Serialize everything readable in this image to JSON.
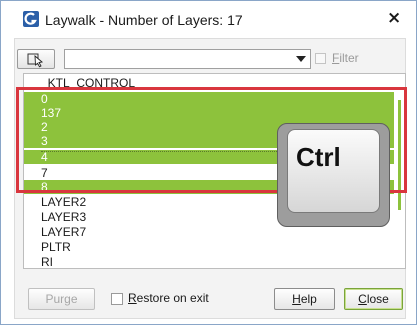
{
  "window": {
    "title": "Laywalk - Number of Layers: 17",
    "close_glyph": "×",
    "app_icon": "autocad-g-icon"
  },
  "toolbar": {
    "pick_icon": "select-objects-icon",
    "filter_value": "",
    "filter_checked": false,
    "filter_label_first": "F",
    "filter_label_rest": "ilter"
  },
  "layers": [
    {
      "name": "_KTL_CONTROL",
      "selected": false
    },
    {
      "name": "0",
      "selected": true
    },
    {
      "name": "137",
      "selected": true
    },
    {
      "name": "2",
      "selected": true
    },
    {
      "name": "3",
      "selected": true
    },
    {
      "name": "4",
      "selected": true
    },
    {
      "name": "7",
      "selected": false
    },
    {
      "name": "8",
      "selected": true
    },
    {
      "name": "LAYER2",
      "selected": false
    },
    {
      "name": "LAYER3",
      "selected": false
    },
    {
      "name": "LAYER7",
      "selected": false
    },
    {
      "name": "PLTR",
      "selected": false
    },
    {
      "name": "RI",
      "selected": false
    }
  ],
  "overlay": {
    "key_label": "Ctrl",
    "highlight_color": "#d9363e",
    "selection_color": "#8dc23c"
  },
  "footer": {
    "purge_label": "Purge",
    "restore_label_first": "R",
    "restore_label_rest": "estore on exit",
    "restore_checked": false,
    "help_label_first": "H",
    "help_label_rest": "elp",
    "close_label_first": "C",
    "close_label_rest": "lose"
  }
}
